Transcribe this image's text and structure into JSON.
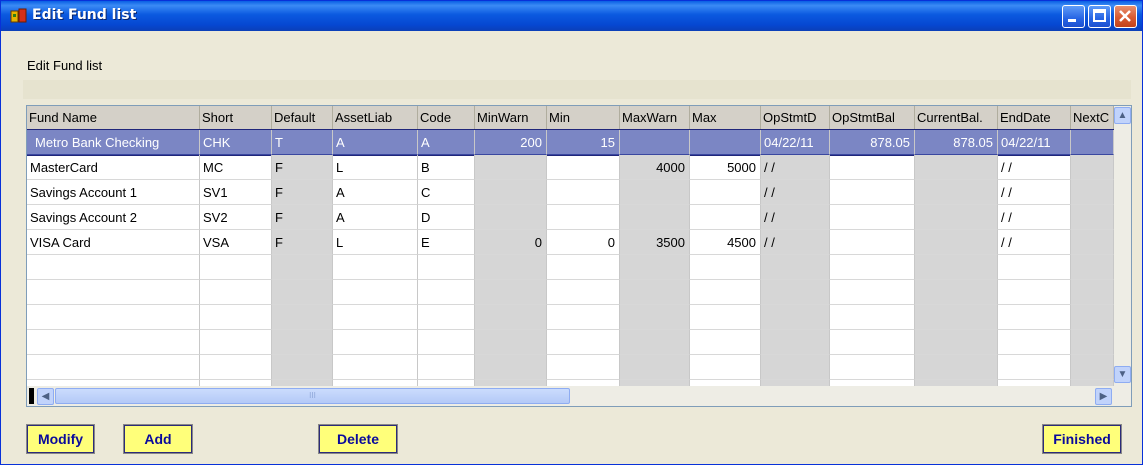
{
  "window": {
    "title": "Edit Fund list"
  },
  "subheader": {
    "text": "Edit Fund list"
  },
  "grid": {
    "columns": [
      "Fund Name",
      "Short",
      "Default",
      "AssetLiab",
      "Code",
      "MinWarn",
      "Min",
      "MaxWarn",
      "Max",
      "OpStmtD",
      "OpStmtBal",
      "CurrentBal.",
      "EndDate",
      "NextC"
    ],
    "rows": [
      [
        "Metro Bank Checking",
        "CHK",
        "T",
        "A",
        "A",
        "200",
        "15",
        "",
        "",
        "04/22/11",
        "878.05",
        "878.05",
        "04/22/11",
        ""
      ],
      [
        "MasterCard",
        "MC",
        "F",
        "L",
        "B",
        "",
        "",
        "4000",
        "5000",
        "/ /",
        "",
        "",
        "/ /",
        ""
      ],
      [
        "Savings Account 1",
        "SV1",
        "F",
        "A",
        "C",
        "",
        "",
        "",
        "",
        "/ /",
        "",
        "",
        "/ /",
        ""
      ],
      [
        "Savings Account 2",
        "SV2",
        "F",
        "A",
        "D",
        "",
        "",
        "",
        "",
        "/ /",
        "",
        "",
        "/ /",
        ""
      ],
      [
        "VISA Card",
        "VSA",
        "F",
        "L",
        "E",
        "0",
        "0",
        "3500",
        "4500",
        "/ /",
        "",
        "",
        "/ /",
        ""
      ]
    ],
    "selected_row": 0,
    "empty_rows": 6,
    "scrollbar": {
      "thumb_label": "III",
      "up_arrow": "▲",
      "down_arrow": "▼",
      "left_arrow": "◀",
      "right_arrow": "▶"
    }
  },
  "buttons": {
    "modify": "Modify",
    "add": "Add",
    "delete": "Delete",
    "finished": "Finished"
  },
  "colors": {
    "title_bar": "#0b5ae0",
    "selection": "#7b86c4",
    "button_face": "#ffff7a",
    "button_text": "#0b0b9c"
  }
}
